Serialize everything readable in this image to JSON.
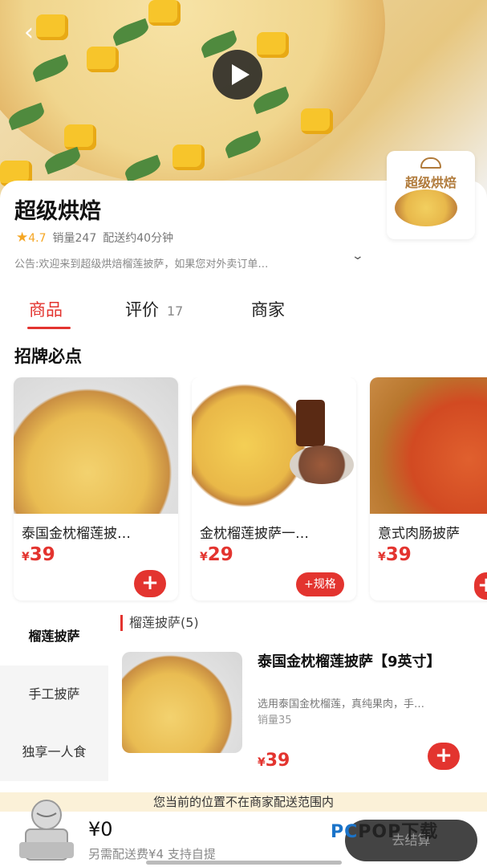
{
  "header": {
    "back_icon": "chevron-left-icon",
    "play_icon": "play-icon"
  },
  "shop": {
    "name": "超级烘焙",
    "rating": "4.7",
    "sales": "销量247",
    "delivery_time": "配送约40分钟",
    "notice": "公告:欢迎来到超级烘焙榴莲披萨，如果您对外卖订单…",
    "logo_text": "超级烘焙"
  },
  "tabs": [
    {
      "label": "商品",
      "active": true
    },
    {
      "label": "评价",
      "count": "17"
    },
    {
      "label": "商家"
    }
  ],
  "featured": {
    "title": "招牌必点",
    "items": [
      {
        "name": "泰国金枕榴莲披…",
        "price": "39",
        "currency": "¥",
        "action": "+"
      },
      {
        "name": "金枕榴莲披萨一…",
        "price": "29",
        "currency": "¥",
        "action": "+规格"
      },
      {
        "name": "意式肉肠披萨",
        "price": "39",
        "currency": "¥",
        "action": "+"
      }
    ]
  },
  "categories": [
    {
      "label": "榴莲披萨",
      "active": true
    },
    {
      "label": "手工披萨"
    },
    {
      "label": "独享一人食"
    }
  ],
  "list": {
    "heading": "榴莲披萨(5)",
    "items": [
      {
        "name": "泰国金枕榴莲披萨【9英寸】",
        "desc": "选用泰国金枕榴莲，真纯果肉，手…",
        "sales": "销量35",
        "price": "39",
        "currency": "¥",
        "action": "+"
      }
    ]
  },
  "bottom": {
    "warning": "您当前的位置不在商家配送范围内",
    "total": "¥0",
    "fee_note": "另需配送费¥4  支持自提",
    "checkout": "去结算",
    "watermark_pc": "PC",
    "watermark_rest": "POP下载"
  },
  "colors": {
    "accent": "#e3342f",
    "rating": "#f5a623",
    "warning_bg": "#fbf1d8"
  }
}
